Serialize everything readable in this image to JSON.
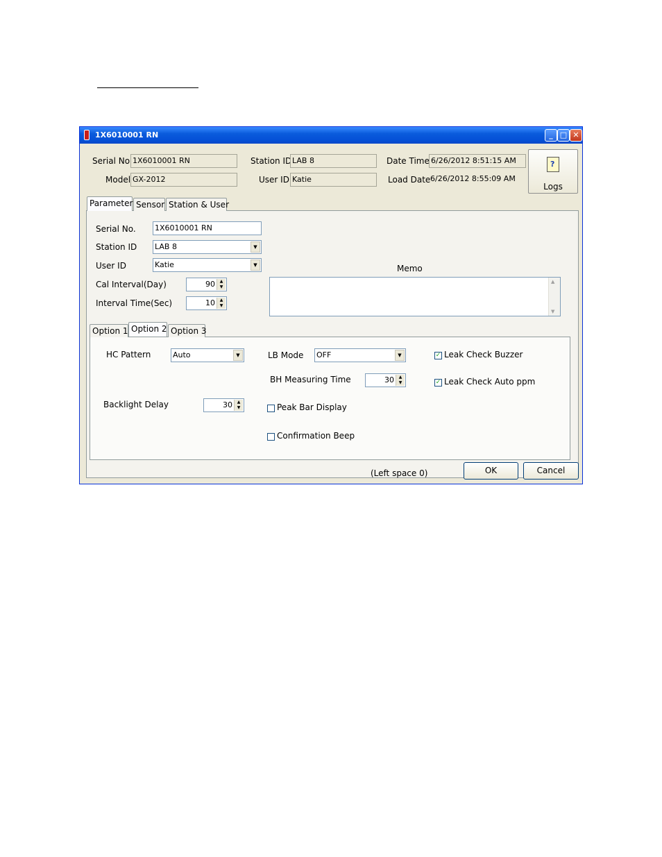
{
  "window": {
    "title": "1X6010001 RN"
  },
  "header": {
    "serial_label": "Serial No.",
    "serial_value": "1X6010001 RN",
    "model_label": "Model",
    "model_value": "GX-2012",
    "station_label": "Station ID",
    "station_value": "LAB 8",
    "user_label": "User ID",
    "user_value": "Katie",
    "datetime_label": "Date Time",
    "datetime_value": "6/26/2012 8:51:15 AM",
    "loaddate_label": "Load Date",
    "loaddate_value": "6/26/2012 8:55:09 AM",
    "logs_label": "Logs"
  },
  "tabs": {
    "parameter": "Parameter",
    "sensor": "Sensor",
    "station_user": "Station & User"
  },
  "parameter": {
    "serial_label": "Serial No.",
    "serial_value": "1X6010001 RN",
    "station_label": "Station ID",
    "station_value": "LAB 8",
    "user_label": "User ID",
    "user_value": "Katie",
    "cal_label": "Cal Interval(Day)",
    "cal_value": "90",
    "interval_label": "Interval Time(Sec)",
    "interval_value": "10",
    "memo_label": "Memo",
    "memo_value": ""
  },
  "option_tabs": {
    "option1": "Option 1",
    "option2": "Option 2",
    "option3": "Option 3"
  },
  "option2": {
    "hc_label": "HC Pattern",
    "hc_value": "Auto",
    "lb_label": "LB Mode",
    "lb_value": "OFF",
    "bh_label": "BH Measuring Time",
    "bh_value": "30",
    "backlight_label": "Backlight Delay",
    "backlight_value": "30",
    "peak_label": "Peak Bar Display",
    "peak_checked": false,
    "beep_label": "Confirmation Beep",
    "beep_checked": false,
    "buzzer_label": "Leak Check Buzzer",
    "buzzer_checked": true,
    "autoppm_label": "Leak Check Auto ppm",
    "autoppm_checked": true
  },
  "footer": {
    "left_space": "(Left space 0)",
    "ok_label": "OK",
    "cancel_label": "Cancel"
  },
  "icons": {
    "check": "✓",
    "dropdown": "▼",
    "spin_up": "▲",
    "spin_down": "▼",
    "minimize": "_",
    "maximize": "□",
    "close": "✕"
  }
}
